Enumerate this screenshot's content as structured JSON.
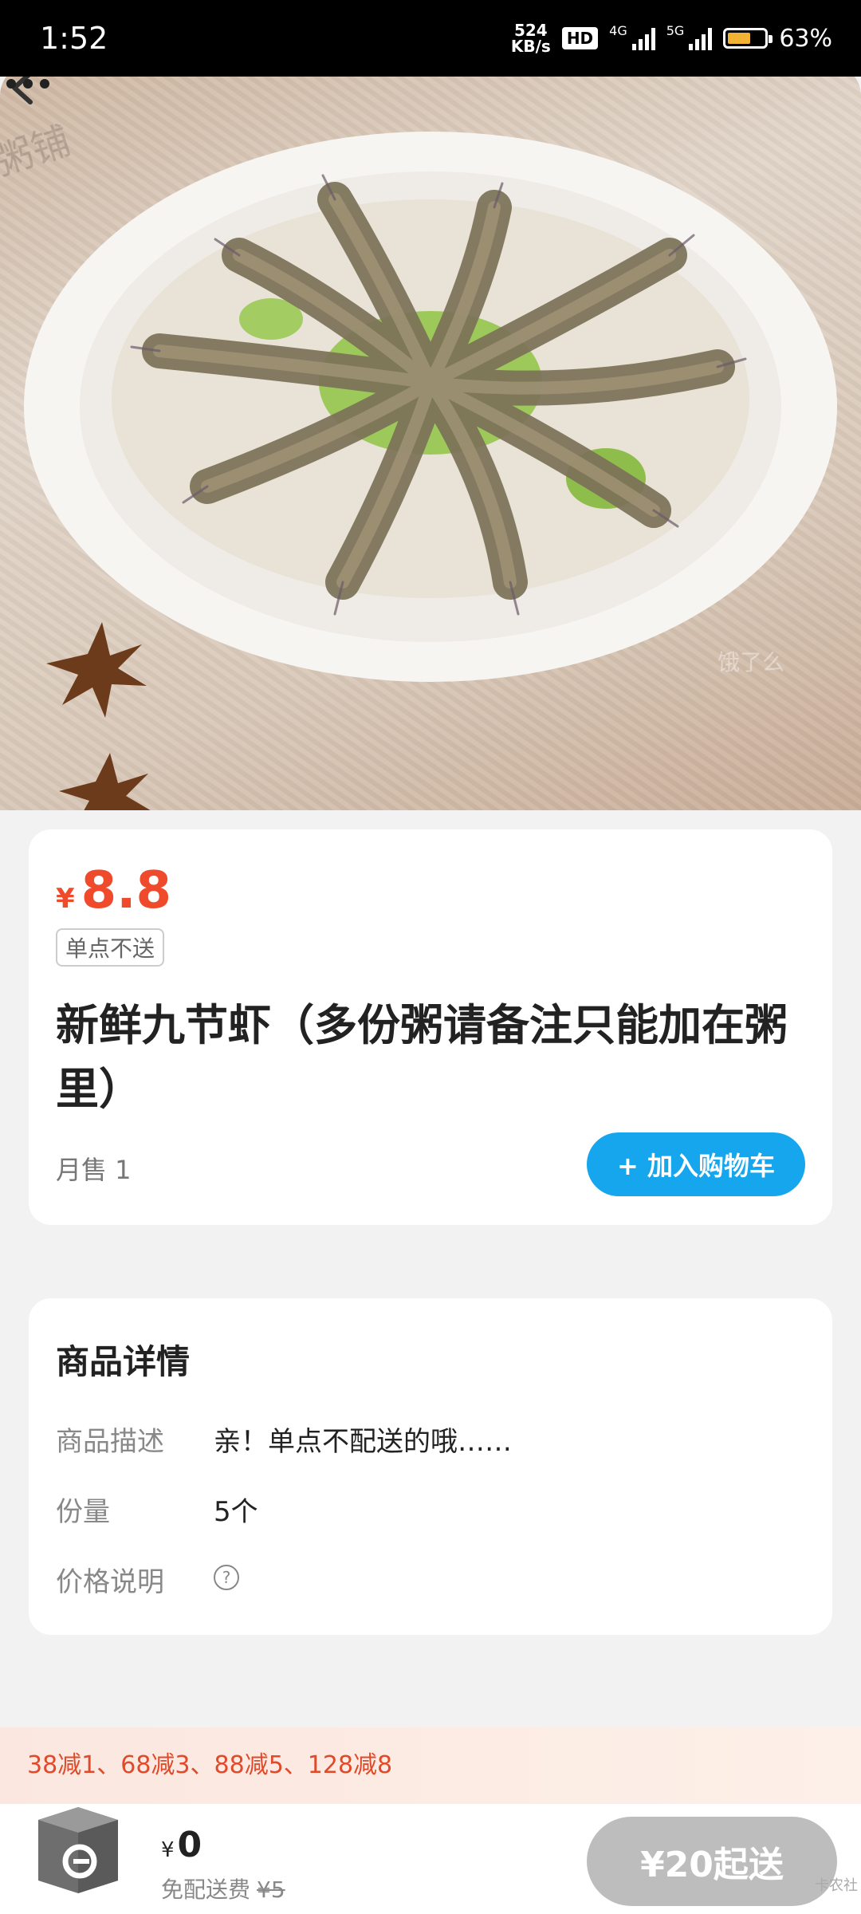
{
  "status_bar": {
    "time": "1:52",
    "speed_value": "524",
    "speed_unit": "KB/s",
    "hd": "HD",
    "net1": "4G",
    "net2": "5G",
    "battery": "63%",
    "battery_level": 0.63
  },
  "product": {
    "image_icon": "shrimp-plate-photo",
    "currency": "¥",
    "price": "8.8",
    "tag": "单点不送",
    "title": "新鲜九节虾（多份粥请备注只能加在粥里）",
    "monthly_sales": "月售 1",
    "add_to_cart": "+ 加入购物车"
  },
  "details": {
    "heading": "商品详情",
    "rows": [
      {
        "key": "商品描述",
        "value": "亲！单点不配送的哦……"
      },
      {
        "key": "份量",
        "value": "5个"
      },
      {
        "key": "价格说明",
        "value": ""
      }
    ],
    "help_icon": "?"
  },
  "promo": "38减1、68减3、88减5、128减8",
  "cart": {
    "currency": "¥",
    "total": "0",
    "delivery_fee_label": "免配送费",
    "delivery_fee_original": "¥5",
    "checkout": "¥20起送"
  },
  "watermark_corner": "卡农社",
  "colors": {
    "price": "#ee4a2b",
    "add_button": "#16a6ee",
    "checkout_disabled": "#bdbdbd"
  }
}
